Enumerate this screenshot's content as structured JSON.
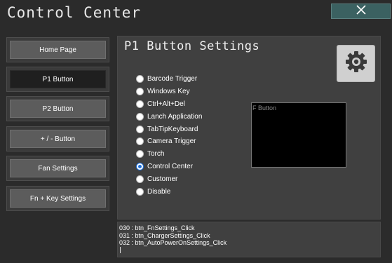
{
  "window": {
    "title": "Control Center",
    "close_icon": "close-icon"
  },
  "sidebar": {
    "items": [
      {
        "label": "Home Page",
        "active": false
      },
      {
        "label": "P1 Button",
        "active": true
      },
      {
        "label": "P2 Button",
        "active": false
      },
      {
        "label": "+ / - Button",
        "active": false
      },
      {
        "label": "Fan Settings",
        "active": false
      },
      {
        "label": "Fn + Key Settings",
        "active": false
      }
    ]
  },
  "panel": {
    "title": "P1 Button Settings",
    "settings_icon": "gear-icon",
    "options": [
      {
        "label": "Barcode Trigger",
        "checked": false
      },
      {
        "label": "Windows Key",
        "checked": false
      },
      {
        "label": "Ctrl+Alt+Del",
        "checked": false
      },
      {
        "label": "Lanch Application",
        "checked": false
      },
      {
        "label": "TabTipKeyboard",
        "checked": false
      },
      {
        "label": "Camera Trigger",
        "checked": false
      },
      {
        "label": "Torch",
        "checked": false
      },
      {
        "label": "Control Center",
        "checked": true
      },
      {
        "label": "Customer",
        "checked": false
      },
      {
        "label": "Disable",
        "checked": false
      }
    ],
    "fbutton_box_label": "F Button"
  },
  "log": {
    "lines": [
      "030 : btn_FnSettings_Click",
      "031 : btn_ChargerSettings_Click",
      "032 : btn_AutoPowerOnSettings_Click"
    ]
  },
  "colors": {
    "background": "#2b2b2b",
    "panel": "#404040",
    "close_button": "#3b6161",
    "radio_accent": "#1e6fd8"
  }
}
